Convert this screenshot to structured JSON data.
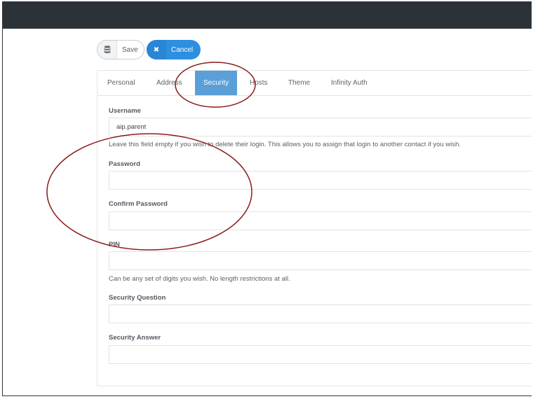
{
  "toolbar": {
    "save_label": "Save",
    "cancel_label": "Cancel"
  },
  "tabs": [
    {
      "label": "Personal",
      "active": false
    },
    {
      "label": "Address",
      "active": false
    },
    {
      "label": "Security",
      "active": true
    },
    {
      "label": "Hosts",
      "active": false
    },
    {
      "label": "Theme",
      "active": false
    },
    {
      "label": "Infinity Auth",
      "active": false
    }
  ],
  "form": {
    "username": {
      "label": "Username",
      "value": "aip.parent",
      "help": "Leave this field empty if you wish to delete their login. This allows you to assign that login to another contact if you wish."
    },
    "password": {
      "label": "Password",
      "value": ""
    },
    "confirm_password": {
      "label": "Confirm Password",
      "value": ""
    },
    "pin": {
      "label": "PIN",
      "value": "",
      "help": "Can be any set of digits you wish. No length restrictions at all."
    },
    "security_question": {
      "label": "Security Question",
      "value": ""
    },
    "security_answer": {
      "label": "Security Answer",
      "value": ""
    }
  },
  "colors": {
    "topbar": "#2c3338",
    "primary": "#2d8fe0",
    "active_tab": "#5b9fd8",
    "annotation": "#8b1a1a"
  }
}
